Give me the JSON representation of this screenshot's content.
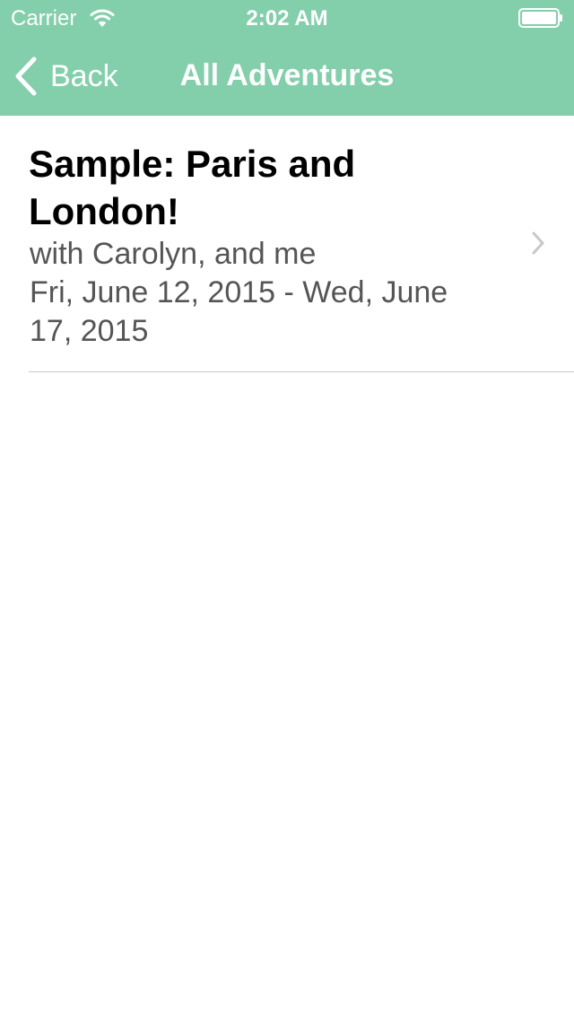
{
  "status_bar": {
    "carrier": "Carrier",
    "time": "2:02 AM",
    "wifi_icon": "wifi-icon",
    "battery_icon": "battery-full-icon"
  },
  "nav": {
    "back_label": "Back",
    "title": "All Adventures"
  },
  "adventures": [
    {
      "title": "Sample: Paris and London!",
      "companions": "with Carolyn, and me",
      "dates": "Fri, June 12, 2015 - Wed, June 17, 2015"
    }
  ],
  "colors": {
    "header_green": "#83ceab",
    "title_text": "#000000",
    "subtitle_text": "#555555",
    "separator": "#c8c7cc",
    "disclosure_chevron": "#c7c7cc"
  }
}
